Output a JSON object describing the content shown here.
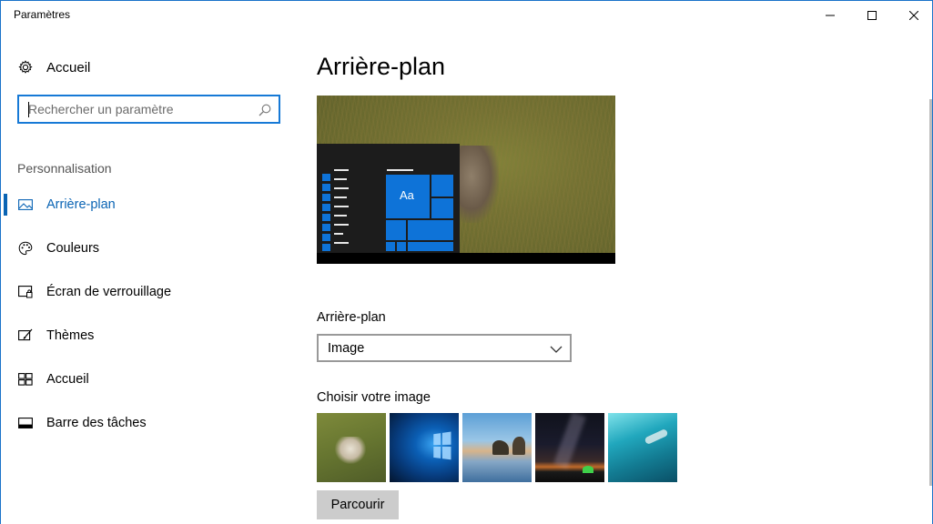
{
  "window": {
    "title": "Paramètres"
  },
  "sidebar": {
    "home_label": "Accueil",
    "search": {
      "placeholder": "Rechercher un paramètre"
    },
    "section_label": "Personnalisation",
    "items": [
      {
        "label": "Arrière-plan",
        "icon": "picture-icon",
        "active": true
      },
      {
        "label": "Couleurs",
        "icon": "palette-icon",
        "active": false
      },
      {
        "label": "Écran de verrouillage",
        "icon": "lock-screen-icon",
        "active": false
      },
      {
        "label": "Thèmes",
        "icon": "brush-icon",
        "active": false
      },
      {
        "label": "Accueil",
        "icon": "start-tiles-icon",
        "active": false
      },
      {
        "label": "Barre des tâches",
        "icon": "taskbar-icon",
        "active": false
      }
    ]
  },
  "main": {
    "title": "Arrière-plan",
    "preview": {
      "tile_text": "Aa"
    },
    "background_label": "Arrière-plan",
    "background_value": "Image",
    "choose_label": "Choisir votre image",
    "browse_label": "Parcourir"
  },
  "colors": {
    "accent": "#0a64b4",
    "tile_blue": "#0e73d8"
  }
}
